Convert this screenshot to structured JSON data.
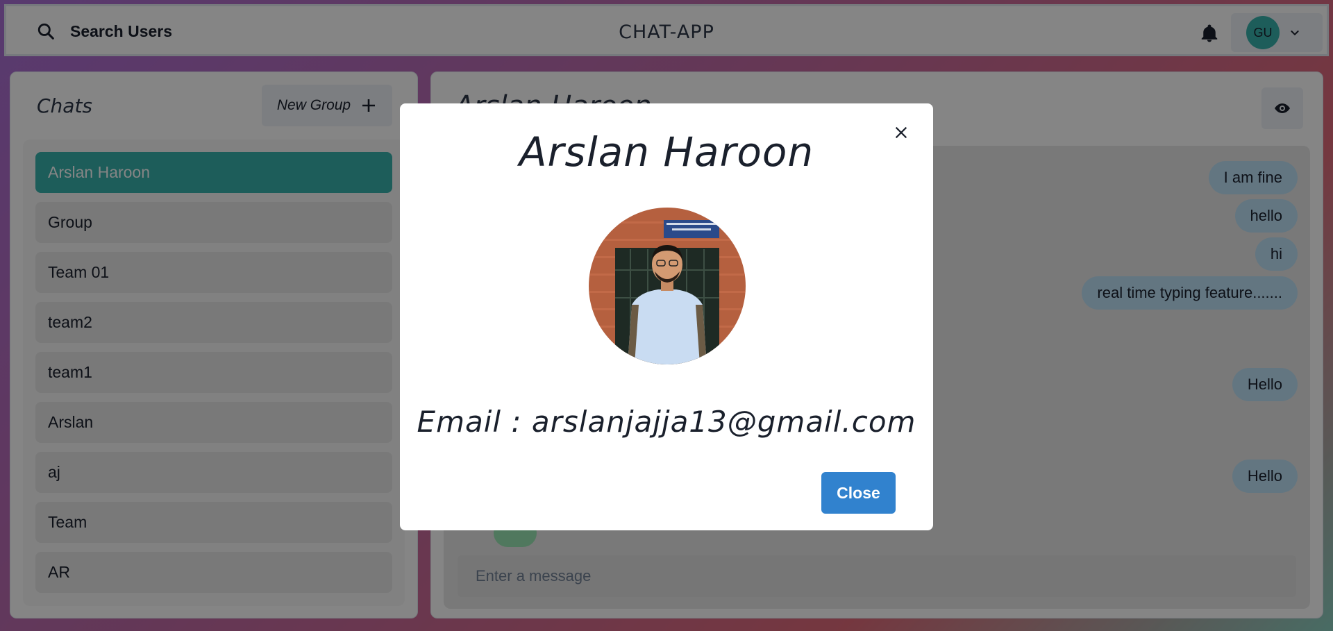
{
  "header": {
    "search_label": "Search Users",
    "app_title": "CHAT-APP",
    "avatar_initials": "GU"
  },
  "sidebar": {
    "title": "Chats",
    "new_group_label": "New Group",
    "chats": [
      {
        "name": "Arslan Haroon",
        "active": true
      },
      {
        "name": "Group"
      },
      {
        "name": "Team 01"
      },
      {
        "name": "team2"
      },
      {
        "name": "team1"
      },
      {
        "name": "Arslan"
      },
      {
        "name": "aj"
      },
      {
        "name": "Team"
      },
      {
        "name": "AR"
      }
    ]
  },
  "chat": {
    "header_name": "Arslan Haroon",
    "messages": [
      "I am fine",
      "hello",
      "hi",
      "real time typing feature.......",
      "Hello",
      "Hello"
    ],
    "input_placeholder": "Enter a message"
  },
  "modal": {
    "title": "Arslan Haroon",
    "email_text": "Email : arslanjajja13@gmail.com",
    "close_label": "Close"
  },
  "colors": {
    "accent_teal": "#38b2ac",
    "message_bubble": "#bee3f8",
    "close_button": "#3182ce"
  }
}
